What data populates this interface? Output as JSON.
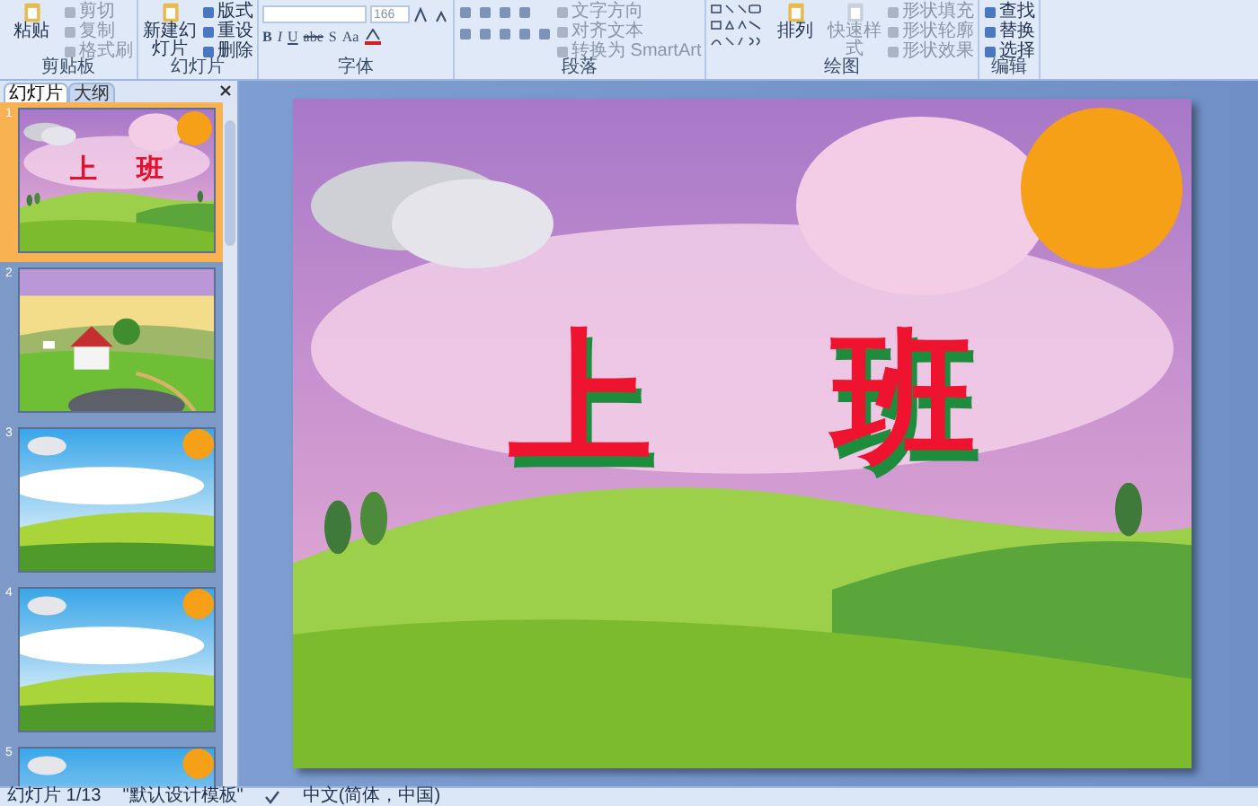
{
  "ribbon": {
    "groups": [
      {
        "kind": "clipboard",
        "label": "剪贴板",
        "large": [
          {
            "label": "粘贴",
            "disabled": false
          }
        ],
        "small": [
          {
            "label": "剪切",
            "disabled": true
          },
          {
            "label": "复制",
            "disabled": true
          },
          {
            "label": "格式刷",
            "disabled": true
          }
        ]
      },
      {
        "kind": "slides",
        "label": "幻灯片",
        "large": [
          {
            "label": "新建幻灯片",
            "disabled": false
          }
        ],
        "small": [
          {
            "label": "版式",
            "disabled": false
          },
          {
            "label": "重设",
            "disabled": false
          },
          {
            "label": "删除",
            "disabled": false
          }
        ]
      },
      {
        "kind": "font",
        "label": "字体",
        "font_size": "166",
        "format_buttons": [
          "B",
          "I",
          "U",
          "abe",
          "S",
          "Aa"
        ]
      },
      {
        "kind": "paragraph",
        "label": "段落",
        "small": [
          {
            "label": "文字方向",
            "disabled": true
          },
          {
            "label": "对齐文本",
            "disabled": true
          },
          {
            "label": "转换为 SmartArt",
            "disabled": true
          }
        ]
      },
      {
        "kind": "drawing",
        "label": "绘图",
        "large": [
          {
            "label": "排列",
            "disabled": false
          },
          {
            "label": "快速样式",
            "disabled": true
          }
        ],
        "small": [
          {
            "label": "形状填充",
            "disabled": true
          },
          {
            "label": "形状轮廓",
            "disabled": true
          },
          {
            "label": "形状效果",
            "disabled": true
          }
        ]
      },
      {
        "kind": "editing",
        "label": "编辑",
        "small": [
          {
            "label": "查找",
            "disabled": false
          },
          {
            "label": "替换",
            "disabled": false
          },
          {
            "label": "选择",
            "disabled": false
          }
        ]
      }
    ]
  },
  "slides_panel": {
    "tabs": [
      {
        "label": "幻灯片",
        "selected": true
      },
      {
        "label": "大纲",
        "selected": false
      }
    ],
    "thumbnails": [
      {
        "number": "1",
        "selected": true,
        "kind": "title",
        "title": [
          "上",
          "班"
        ]
      },
      {
        "number": "2",
        "selected": false,
        "kind": "village"
      },
      {
        "number": "3",
        "selected": false,
        "kind": "sky"
      },
      {
        "number": "4",
        "selected": false,
        "kind": "sky"
      },
      {
        "number": "5",
        "selected": false,
        "kind": "sky"
      }
    ]
  },
  "slide": {
    "kind": "title",
    "title": [
      "上",
      "班"
    ]
  },
  "status_bar": [
    "幻灯片 1/13",
    "\"默认设计模板\"",
    "中文(简体，中国)"
  ]
}
